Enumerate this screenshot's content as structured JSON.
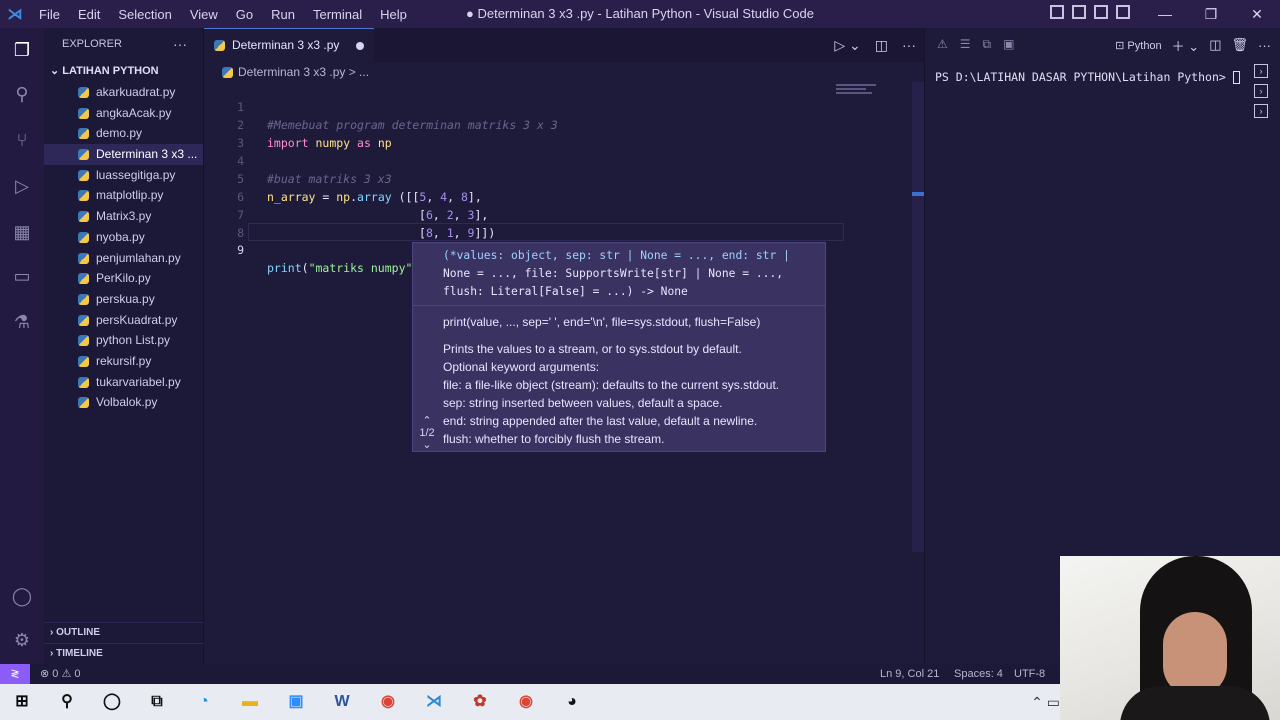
{
  "window": {
    "title": "● Determinan 3 x3 .py - Latihan Python - Visual Studio Code",
    "menu": [
      "File",
      "Edit",
      "Selection",
      "View",
      "Go",
      "Run",
      "Terminal",
      "Help"
    ]
  },
  "sidebar": {
    "header": "EXPLORER",
    "folder": "LATIHAN PYTHON",
    "files": [
      "akarkuadrat.py",
      "angkaAcak.py",
      "demo.py",
      "Determinan 3 x3 ...",
      "luassegitiga.py",
      "matplotlip.py",
      "Matrix3.py",
      "nyoba.py",
      "penjumlahan.py",
      "PerKilo.py",
      "perskua.py",
      "persKuadrat.py",
      "python List.py",
      "rekursif.py",
      "tukarvariabel.py",
      "Volbalok.py"
    ],
    "selected_index": 3,
    "outline": "OUTLINE",
    "timeline": "TIMELINE"
  },
  "editor": {
    "tab_label": "Determinan 3 x3 .py",
    "breadcrumb": "Determinan 3 x3 .py > ...",
    "lines": {
      "l1_comment": "#Memebuat program determinan matriks 3 x 3",
      "l2_import": "import",
      "l2_numpy": "numpy",
      "l2_as": "as",
      "l2_np": "np",
      "l4_comment": "#buat matriks 3 x3",
      "l5_var": "n_array",
      "l5_eq": " = ",
      "l5_np": "np",
      "l5_dot": ".",
      "l5_fn": "array",
      "l5_open": " ([[",
      "l5_nums": [
        "5",
        "4",
        "8"
      ],
      "l5_close": "],",
      "l6_open": "[",
      "l6_nums": [
        "6",
        "2",
        "3"
      ],
      "l6_close": "],",
      "l7_open": "[",
      "l7_nums": [
        "8",
        "1",
        "9"
      ],
      "l7_close": "]])",
      "l9_fn": "print",
      "l9_open": "(",
      "l9_str": "\"matriks numpy\"",
      "l9_close": ")"
    },
    "line_numbers": [
      "1",
      "2",
      "3",
      "4",
      "5",
      "6",
      "7",
      "8",
      "9"
    ]
  },
  "hover": {
    "sig_1": "(*values: object, sep: str | None = ..., end: str |",
    "sig_2": "None = ..., file: SupportsWrite[str] | None = ...,",
    "sig_3": "flush: Literal[False] = ...) -> None",
    "call": "print(value, ..., sep=' ', end='\\n', file=sys.stdout, flush=False)",
    "desc": [
      "Prints the values to a stream, or to sys.stdout by default.",
      "Optional keyword arguments:",
      "file: a file-like object (stream): defaults to the current sys.stdout.",
      "sep: string inserted between values, default a space.",
      "end: string appended after the last value, default a newline.",
      "flush: whether to forcibly flush the stream."
    ],
    "pager": "1/2"
  },
  "panel": {
    "shell": "Python",
    "prompt": "PS D:\\LATIHAN DASAR PYTHON\\Latihan Python>"
  },
  "status": {
    "problems": "⊗ 0 ⚠ 0",
    "position": "Ln 9, Col 21",
    "spaces": "Spaces: 4",
    "encoding": "UTF-8"
  },
  "colors": {
    "accent": "#8b5cf6",
    "editor_bg": "#1e1b3a",
    "keyword": "#ff8fd0",
    "string": "#9ff29a"
  }
}
